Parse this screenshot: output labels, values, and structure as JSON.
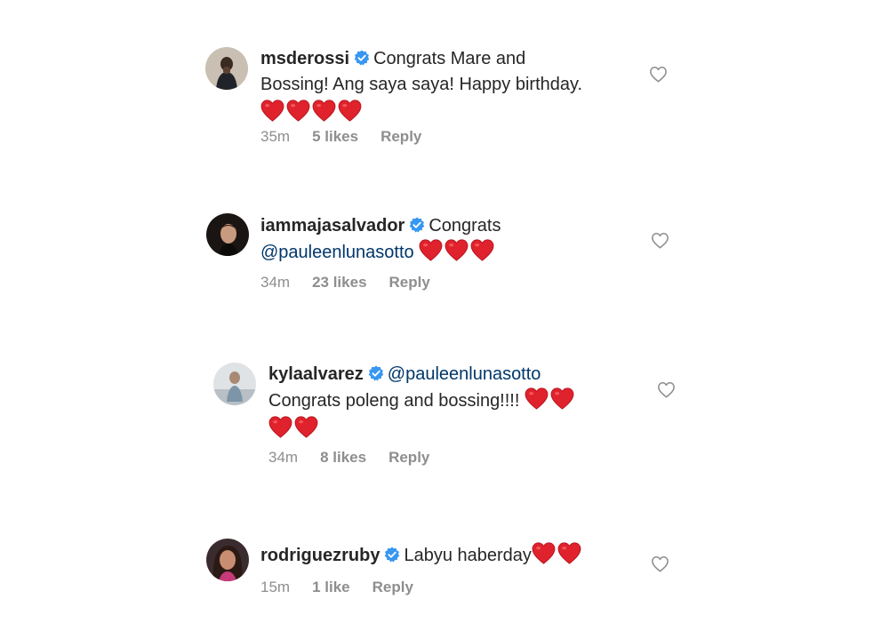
{
  "comments": [
    {
      "username": "msderossi",
      "text_line1": "Congrats Mare and",
      "text_line2": "Bossing! Ang saya saya! Happy birthday.",
      "time": "35m",
      "likes": "5 likes",
      "reply": "Reply"
    },
    {
      "username": "iammajasalvador",
      "text_line1": "Congrats",
      "mention": "@pauleenlunasotto",
      "time": "34m",
      "likes": "23 likes",
      "reply": "Reply"
    },
    {
      "username": "kylaalvarez",
      "mention": "@pauleenlunasotto",
      "text_line1": "Congrats poleng and bossing!!!!",
      "time": "34m",
      "likes": "8 likes",
      "reply": "Reply"
    },
    {
      "username": "rodriguezruby",
      "text_line1": "Labyu haberday",
      "time": "15m",
      "likes": "1 like",
      "reply": "Reply"
    }
  ],
  "icons": {
    "verified": "verified-badge-icon",
    "heart_emoji": "red-heart-emoji",
    "like": "heart-outline-icon"
  },
  "colors": {
    "verified": "#3897f0",
    "heart": "#e8202a",
    "mention": "#00376b",
    "meta": "#8e8e8e"
  }
}
